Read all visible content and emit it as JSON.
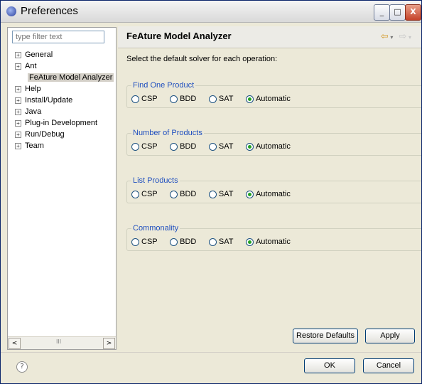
{
  "window": {
    "title": "Preferences"
  },
  "filter": {
    "placeholder": "type filter text"
  },
  "tree": [
    {
      "label": "General",
      "expandable": true
    },
    {
      "label": "Ant",
      "expandable": true
    },
    {
      "label": "FeAture Model Analyzer",
      "expandable": false,
      "selected": true
    },
    {
      "label": "Help",
      "expandable": true
    },
    {
      "label": "Install/Update",
      "expandable": true
    },
    {
      "label": "Java",
      "expandable": true
    },
    {
      "label": "Plug-in Development",
      "expandable": true
    },
    {
      "label": "Run/Debug",
      "expandable": true
    },
    {
      "label": "Team",
      "expandable": true
    }
  ],
  "page": {
    "title": "FeAture Model Analyzer",
    "description": "Select the default solver for each operation:"
  },
  "options": {
    "csp": "CSP",
    "bdd": "BDD",
    "sat": "SAT",
    "automatic": "Automatic"
  },
  "groups": [
    {
      "label": "Find One Product",
      "selected": "Automatic"
    },
    {
      "label": "Number of Products",
      "selected": "Automatic"
    },
    {
      "label": "List Products",
      "selected": "Automatic"
    },
    {
      "label": "Commonality",
      "selected": "Automatic"
    }
  ],
  "buttons": {
    "restore_defaults": "Restore Defaults",
    "apply": "Apply",
    "ok": "OK",
    "cancel": "Cancel"
  },
  "icons": {
    "help": "?",
    "back": "⇦",
    "forward": "⇨",
    "expand": "+",
    "scroll_left": "<",
    "scroll_right": ">",
    "scroll_grip": "III",
    "minimize": "_",
    "maximize": "□",
    "close": "X"
  },
  "colors": {
    "accent": "#1f4fbf",
    "radio_checked": "#21a121",
    "title_bar_close": "#c5432a"
  }
}
